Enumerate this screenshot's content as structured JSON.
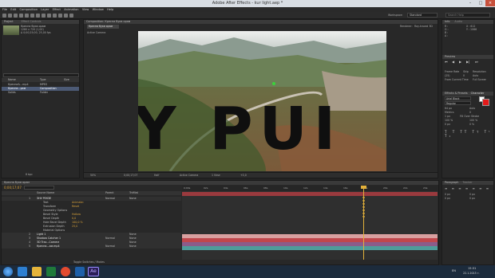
{
  "window": {
    "title": "Adobe After Effects - kur light.aep *"
  },
  "menu": [
    "File",
    "Edit",
    "Composition",
    "Layer",
    "Effect",
    "Animation",
    "View",
    "Window",
    "Help"
  ],
  "toolbar": {
    "workspace_label": "Workspace:",
    "workspace_value": "Standard",
    "search_placeholder": "Search Help"
  },
  "project": {
    "tab": "Project",
    "effect_tab": "Effect Controls",
    "selected_name": "Кресна букв орам",
    "selected_info": "1280 x 720 (1,00)",
    "selected_duration": "Δ 0;00;25;00, 25,00 fps",
    "search_placeholder": "",
    "columns": {
      "name": "Name",
      "type": "Type",
      "size": "Size"
    },
    "items": [
      {
        "name": "Кресна&...mp4",
        "type": "MPEG",
        "size": ""
      },
      {
        "name": "Кресна...рам",
        "type": "Composition",
        "size": ""
      },
      {
        "name": "Solids",
        "type": "Folder",
        "size": ""
      }
    ],
    "bpc": "8 bpc"
  },
  "composition": {
    "tab": "Composition: Кресна букв орам",
    "subtab": "Кресна букв орам",
    "renderer_label": "Renderer:",
    "renderer_value": "Ray-traced 3D",
    "camera_label": "Active Camera",
    "overlay_text": "Y PUI",
    "footer": {
      "zoom": "50%",
      "timecode": "0;00;17;07",
      "quality": "Half",
      "view": "Active Camera",
      "views": "1 View",
      "offset": "+0,0"
    }
  },
  "info_panel": {
    "tab": "Info",
    "audio_tab": "Audio",
    "r": "R :",
    "g": "G :",
    "b": "B :",
    "a": "A :",
    "x": "X : 612",
    "y": "Y : 1066"
  },
  "preview": {
    "tab": "Preview",
    "frame_rate": "Frame Rate",
    "skip": "Skip",
    "resolution": "Resolution",
    "fps": "(25)",
    "skip_val": "0",
    "res_val": "Auto",
    "from_current": "From Current Time",
    "full_screen": "Full Screen"
  },
  "effects": {
    "tab": "Effects & Presets",
    "search_placeholder": ""
  },
  "character": {
    "tab": "Character",
    "font": "Arial Black",
    "style": "Regular",
    "size": "64 px",
    "leading": "Auto",
    "kerning": "Metrics",
    "tracking": "0",
    "stroke": "1 px",
    "stroke_mode": "Fill Over Stroke",
    "vscale": "100 %",
    "hscale": "100 %",
    "baseline": "0 px",
    "tsume": "0 %"
  },
  "timeline": {
    "tab": "Кресна букв орам",
    "timecode": "0;00;17;07",
    "search_placeholder": "",
    "columns": {
      "name": "Source Name",
      "mode": "Mode",
      "trkmat": "TrkMat",
      "parent": "Parent"
    },
    "ticks": [
      "0;00s",
      "02s",
      "04s",
      "06s",
      "08s",
      "10s",
      "12s",
      "14s",
      "16s",
      "18s",
      "20s",
      "22s",
      "24s"
    ],
    "layers": [
      {
        "num": "1",
        "name": "ЗНУ РЕКЗЕ",
        "kind": "text",
        "mode": "Normal",
        "parent": "None"
      },
      {
        "num": "",
        "name": "Text",
        "kind": "prop",
        "value": "Animate:"
      },
      {
        "num": "",
        "name": "Transform",
        "kind": "prop",
        "value": "Reset"
      },
      {
        "num": "",
        "name": "Geometry Options",
        "kind": "prop",
        "value": ""
      },
      {
        "num": "",
        "name": "Bevel Style",
        "kind": "prop",
        "value": "Hollow"
      },
      {
        "num": "",
        "name": "Bevel Depth",
        "kind": "prop",
        "value": "0,0"
      },
      {
        "num": "",
        "name": "Hole Bevel Depth",
        "kind": "prop",
        "value": "100,0 %"
      },
      {
        "num": "",
        "name": "Extrusion Depth",
        "kind": "prop",
        "value": "25,0"
      },
      {
        "num": "",
        "name": "Material Options",
        "kind": "prop",
        "value": ""
      },
      {
        "num": "2",
        "name": "Light 1",
        "kind": "light",
        "mode": "",
        "parent": "None"
      },
      {
        "num": "3",
        "name": "Shadow Catcher 1",
        "kind": "solid",
        "mode": "Normal",
        "parent": "None"
      },
      {
        "num": "4",
        "name": "3D Trac...Camera",
        "kind": "camera",
        "mode": "",
        "parent": "None"
      },
      {
        "num": "5",
        "name": "Кресна...ам.mp4",
        "kind": "video",
        "mode": "Normal",
        "parent": "None"
      }
    ],
    "footer_label": "Toggle Switches / Modes"
  },
  "paragraph": {
    "tab": "Paragraph",
    "tracker_tab": "Tracker",
    "indent_left": "0 px",
    "indent_right": "0 px",
    "space_before": "0 px",
    "space_after": "0 px"
  },
  "taskbar": {
    "lang": "EN",
    "time": "15:31",
    "date": "22.1.2015 г."
  },
  "colors": {
    "accent": "#d6a03a",
    "layer_red": "#c0474c",
    "layer_pink": "#d8a0a0",
    "layer_teal": "#4e9c9a",
    "cti": "#e3b13b"
  }
}
